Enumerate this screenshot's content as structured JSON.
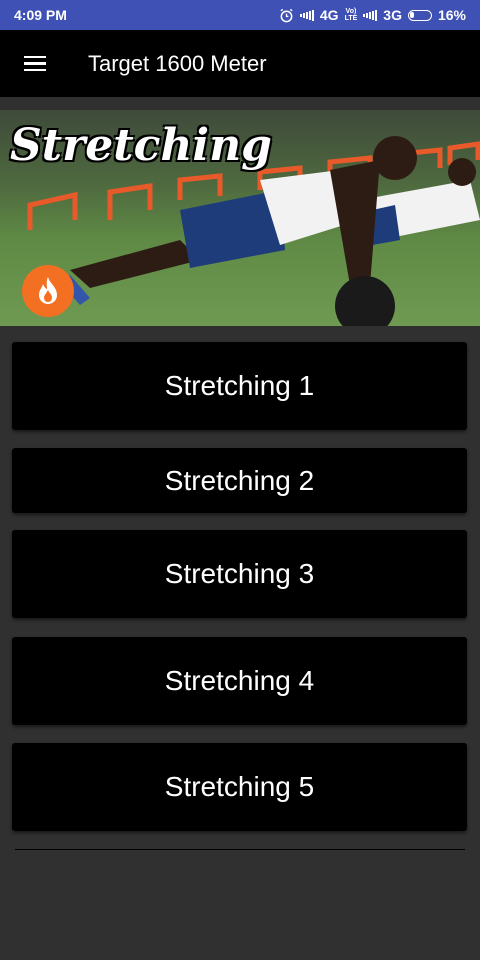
{
  "status_bar": {
    "time": "4:09 PM",
    "net1": "4G",
    "volte_top": "Vo)",
    "volte_bottom": "LTE",
    "net2": "3G",
    "battery": "16%"
  },
  "app_bar": {
    "title": "Target 1600 Meter",
    "menu_icon": "hamburger-menu-icon"
  },
  "banner": {
    "title": "Stretching",
    "badge_icon": "fire-icon",
    "badge_color": "#f36f21"
  },
  "items": [
    {
      "label": "Stretching 1"
    },
    {
      "label": "Stretching 2"
    },
    {
      "label": "Stretching 3"
    },
    {
      "label": "Stretching 4"
    },
    {
      "label": "Stretching 5"
    }
  ],
  "colors": {
    "status_bar": "#3f51b5",
    "app_bar": "#000000",
    "background": "#303030",
    "button": "#000000"
  }
}
